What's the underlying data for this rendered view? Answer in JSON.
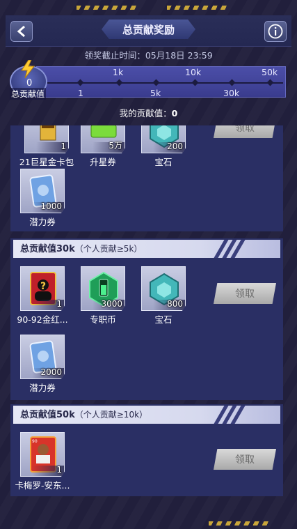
{
  "header": {
    "title": "总贡献奖励"
  },
  "deadline": "领奖截止时间：05月18日 23:59",
  "progress": {
    "current_total": "0",
    "total_label": "总贡献值",
    "top_ticks": [
      "1k",
      "10k",
      "50k"
    ],
    "bottom_ticks": [
      "1",
      "5k",
      "30k"
    ]
  },
  "my_contribution": {
    "label": "我的贡献值：",
    "value": "0"
  },
  "tiers": [
    {
      "claim_label": "领取",
      "items": [
        {
          "name": "21巨星金卡包",
          "count": "1",
          "icon": "card-pack-icon"
        },
        {
          "name": "升星券",
          "count": "5万",
          "icon": "star-ticket-icon"
        },
        {
          "name": "宝石",
          "count": "200",
          "icon": "gem-icon"
        },
        {
          "name": "潜力券",
          "count": "1000",
          "icon": "potential-ticket-icon"
        }
      ]
    },
    {
      "title": "总贡献值30k",
      "sub": "（个人贡献≥5k）",
      "claim_label": "领取",
      "items": [
        {
          "name": "90-92金红...",
          "count": "1",
          "icon": "mystery-player-card-icon"
        },
        {
          "name": "专职币",
          "count": "3000",
          "icon": "battery-coin-icon"
        },
        {
          "name": "宝石",
          "count": "800",
          "icon": "gem-icon"
        },
        {
          "name": "潜力券",
          "count": "2000",
          "icon": "potential-ticket-icon"
        }
      ]
    },
    {
      "title": "总贡献值50k",
      "sub": "（个人贡献≥10k）",
      "claim_label": "领取",
      "items": [
        {
          "name": "卡梅罗-安东...",
          "count": "1",
          "icon": "player-card-icon"
        }
      ]
    }
  ],
  "colors": {
    "background": "#211f3c",
    "panel": "#2a2f64",
    "accent_gold": "#c9a63a",
    "track": "#4b4ea8"
  }
}
